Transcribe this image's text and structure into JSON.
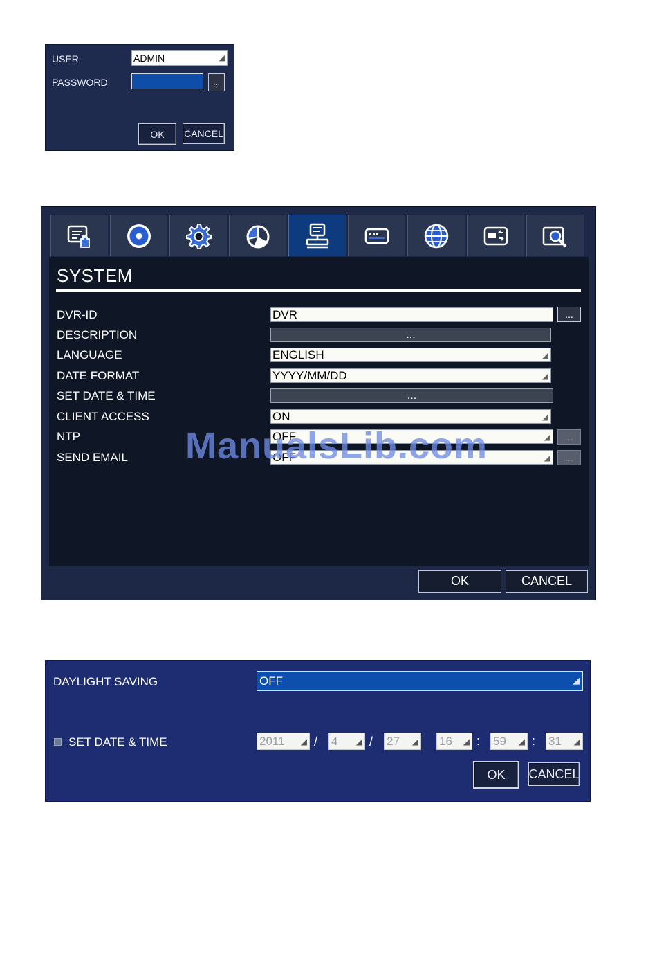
{
  "login": {
    "user_label": "USER",
    "user_value": "ADMIN",
    "password_label": "PASSWORD",
    "password_value": "",
    "more_label": "...",
    "ok_label": "OK",
    "cancel_label": "CANCEL"
  },
  "system": {
    "title": "SYSTEM",
    "tabs": [
      {
        "icon": "display-hand-icon",
        "active": false
      },
      {
        "icon": "record-disc-icon",
        "active": false
      },
      {
        "icon": "gear-icon",
        "active": false
      },
      {
        "icon": "pie-chart-icon",
        "active": false
      },
      {
        "icon": "system-computer-icon",
        "active": true
      },
      {
        "icon": "keyboard-icon",
        "active": false
      },
      {
        "icon": "globe-icon",
        "active": false
      },
      {
        "icon": "backup-device-icon",
        "active": false
      },
      {
        "icon": "search-icon",
        "active": false
      }
    ],
    "rows": {
      "dvr_id": {
        "label": "DVR-ID",
        "value": "DVR",
        "button": "..."
      },
      "description": {
        "label": "DESCRIPTION",
        "value": "..."
      },
      "language": {
        "label": "LANGUAGE",
        "value": "ENGLISH"
      },
      "date_format": {
        "label": "DATE FORMAT",
        "value": "YYYY/MM/DD"
      },
      "set_date_time": {
        "label": "SET DATE & TIME",
        "value": "..."
      },
      "client_access": {
        "label": "CLIENT ACCESS",
        "value": "ON"
      },
      "ntp": {
        "label": "NTP",
        "value": "OFF",
        "button": "..."
      },
      "send_email": {
        "label": "SEND EMAIL",
        "value": "OFF",
        "button": "..."
      }
    },
    "ok_label": "OK",
    "cancel_label": "CANCEL",
    "watermark": "ManualsLib.com"
  },
  "daylight": {
    "daylight_label": "DAYLIGHT SAVING",
    "daylight_value": "OFF",
    "set_label": "SET DATE & TIME",
    "checkbox_checked": false,
    "year": "2011",
    "month": "4",
    "day": "27",
    "hour": "16",
    "minute": "59",
    "second": "31",
    "date_sep": "/",
    "time_sep": ":",
    "ok_label": "OK",
    "cancel_label": "CANCEL"
  },
  "colors": {
    "panel_navy": "#1f2a4f",
    "daylight_panel": "#1e2c72",
    "active_tab": "#0e3a7e",
    "select_blue": "#0c4fad"
  }
}
